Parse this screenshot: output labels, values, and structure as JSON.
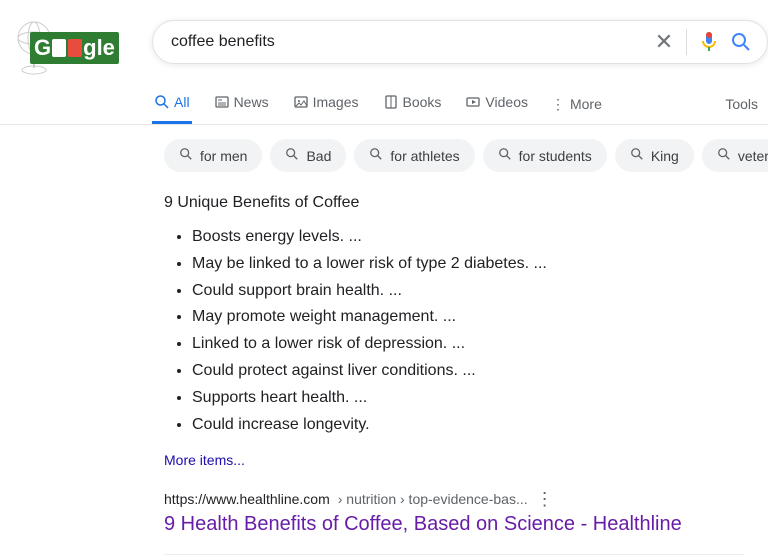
{
  "search": {
    "query": "coffee benefits"
  },
  "tabs": {
    "all": "All",
    "news": "News",
    "images": "Images",
    "books": "Books",
    "videos": "Videos",
    "more": "More",
    "tools": "Tools"
  },
  "chips": [
    "for men",
    "Bad",
    "for athletes",
    "for students",
    "King",
    "veterans"
  ],
  "snippet": {
    "heading": "9 Unique Benefits of Coffee",
    "items": [
      "Boosts energy levels. ...",
      "May be linked to a lower risk of type 2 diabetes. ...",
      "Could support brain health. ...",
      "May promote weight management. ...",
      "Linked to a lower risk of depression. ...",
      "Could protect against liver conditions. ...",
      "Supports heart health. ...",
      "Could increase longevity."
    ],
    "more": "More items..."
  },
  "result": {
    "domain": "https://www.healthline.com",
    "path": " › nutrition › top-evidence-bas...",
    "title": "9 Health Benefits of Coffee, Based on Science - Healthline"
  }
}
